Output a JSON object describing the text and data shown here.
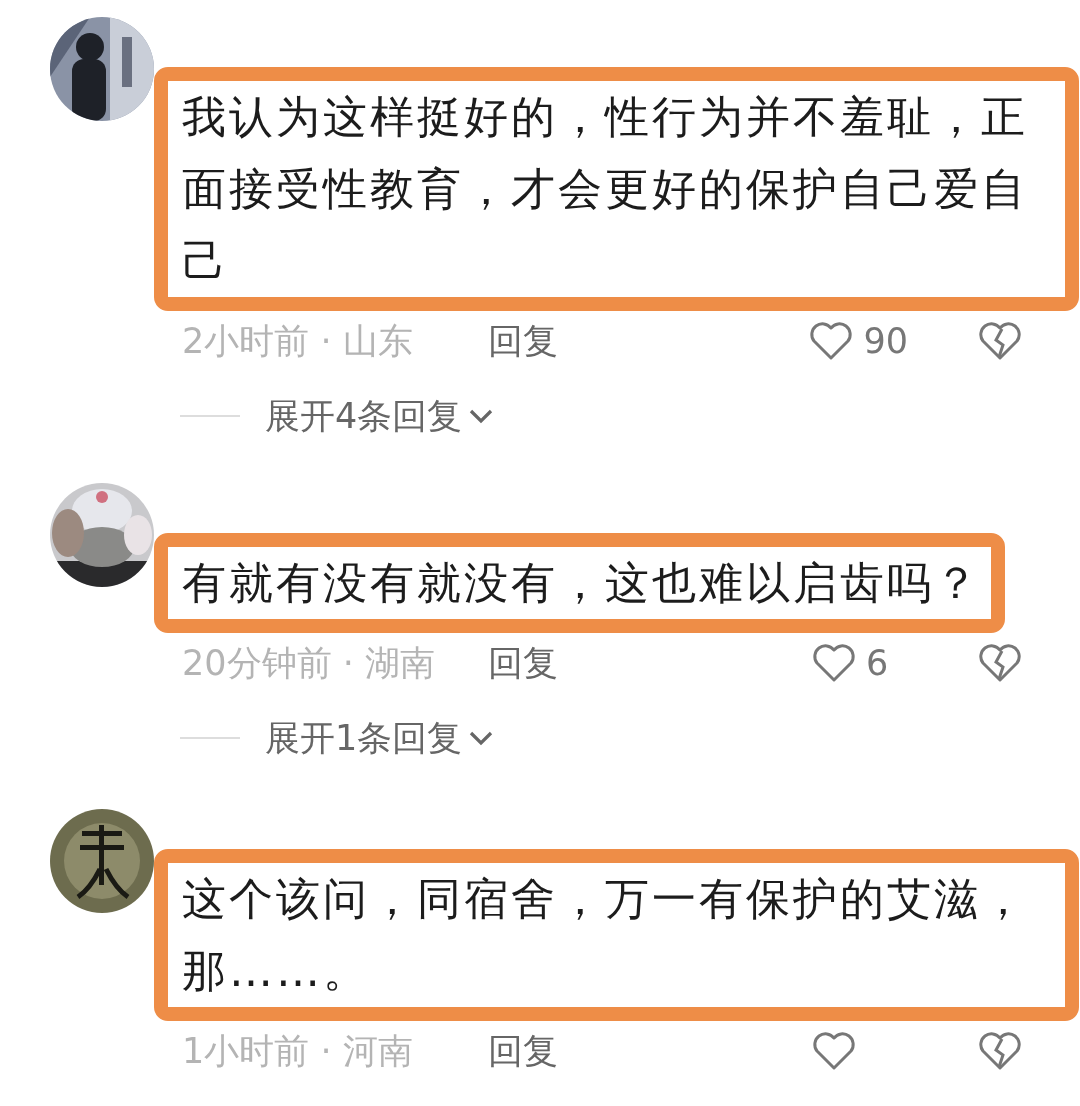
{
  "comments": [
    {
      "highlighted": true,
      "text": "我认为这样挺好的，性行为并不羞耻，正面接受性教育，才会更好的保护自己爱自己",
      "meta": "2小时前 · 山东",
      "reply": "回复",
      "likes": "90",
      "expand": "展开4条回复"
    },
    {
      "highlighted": true,
      "text": "有就有没有就没有，这也难以启齿吗？",
      "meta": "20分钟前 · 湖南",
      "reply": "回复",
      "likes": "6",
      "expand": "展开1条回复"
    },
    {
      "highlighted": true,
      "text": "这个该问，同宿舍，万一有保护的艾滋，那……。",
      "meta": "1小时前 · 河南",
      "reply": "回复"
    }
  ]
}
